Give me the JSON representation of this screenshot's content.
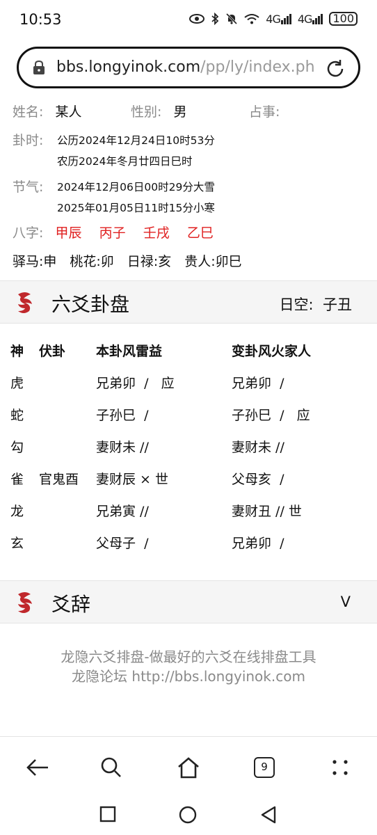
{
  "status": {
    "time": "10:53",
    "battery": "100",
    "net1": "4G",
    "net2": "4G"
  },
  "browser": {
    "url_host": "bbs.longyinok.com",
    "url_path": "/pp/ly/index.ph"
  },
  "info": {
    "name_label": "姓名:",
    "name_value": "某人",
    "gender_label": "性别:",
    "gender_value": "男",
    "matter_label": "占事:",
    "time_label": "卦时:",
    "solar": "公历2024年12月24日10时53分",
    "lunar": "农历2024年冬月廿四日巳时",
    "jieqi_label": "节气:",
    "jieqi1": "2024年12月06日00时29分大雪",
    "jieqi2": "2025年01月05日11时15分小寒",
    "bazi_label": "八字:",
    "bazi": [
      "甲辰",
      "丙子",
      "壬戌",
      "乙巳"
    ],
    "shensha": "驿马:申　桃花:卯　日禄:亥　贵人:卯巳"
  },
  "panel": {
    "title": "六爻卦盘",
    "kong": "日空:  子丑"
  },
  "table": {
    "headers": {
      "shen": "神",
      "fu": "伏卦",
      "ben": "本卦风雷益",
      "bian": "变卦风火家人"
    },
    "rows": [
      {
        "shen": "虎",
        "fu": "",
        "ben": "兄弟卯  /   应",
        "bian": "兄弟卯  /"
      },
      {
        "shen": "蛇",
        "fu": "",
        "ben": "子孙巳  /",
        "bian": "子孙巳  /   应"
      },
      {
        "shen": "勾",
        "fu": "",
        "ben": "妻财未 //",
        "bian": "妻财未 //"
      },
      {
        "shen": "雀",
        "fu": "官鬼酉",
        "ben": "妻财辰 × 世",
        "bian": "父母亥  /"
      },
      {
        "shen": "龙",
        "fu": "",
        "ben": "兄弟寅 //",
        "bian": "妻财丑 // 世"
      },
      {
        "shen": "玄",
        "fu": "",
        "ben": "父母子  /",
        "bian": "兄弟卯  /"
      }
    ]
  },
  "yaoci": {
    "title": "爻辞",
    "toggle": "V"
  },
  "footer": {
    "line1": "龙隐六爻排盘-做最好的六爻在线排盘工具",
    "line2": "龙隐论坛 http://bbs.longyinok.com"
  },
  "nav": {
    "tabs_count": "9"
  },
  "colors": {
    "accent_red": "#e02020",
    "label_gray": "#8a8a8a",
    "logo_red": "#c0282c"
  }
}
